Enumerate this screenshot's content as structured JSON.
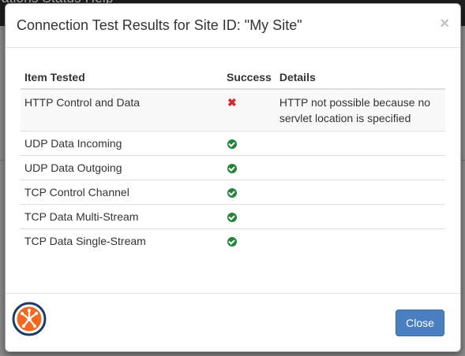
{
  "background": {
    "nav_text": "ations   Status   Help"
  },
  "dialog": {
    "title": "Connection Test Results for Site ID: \"My Site\"",
    "close_symbol": "×",
    "table": {
      "headers": [
        "Item Tested",
        "Success",
        "Details"
      ],
      "rows": [
        {
          "item": "HTTP Control and Data",
          "success": false,
          "details": "HTTP not possible because no servlet location is specified"
        },
        {
          "item": "UDP Data Incoming",
          "success": true,
          "details": ""
        },
        {
          "item": "UDP Data Outgoing",
          "success": true,
          "details": ""
        },
        {
          "item": "TCP Control Channel",
          "success": true,
          "details": ""
        },
        {
          "item": "TCP Data Multi-Stream",
          "success": true,
          "details": ""
        },
        {
          "item": "TCP Data Single-Stream",
          "success": true,
          "details": ""
        }
      ]
    },
    "close_button_label": "Close"
  },
  "colors": {
    "success_icon": "#22863a",
    "failure_icon": "#d9292b",
    "primary_button": "#4a7fc1",
    "logo_orange": "#f26a21",
    "logo_navy": "#1f3b63"
  }
}
